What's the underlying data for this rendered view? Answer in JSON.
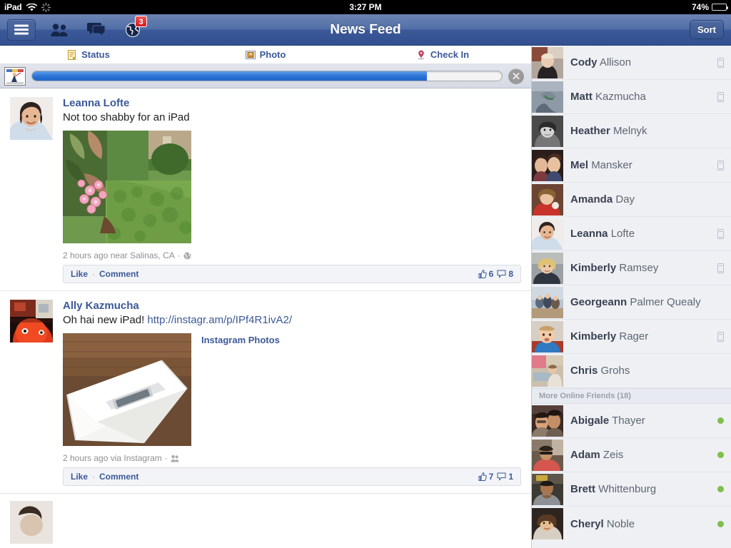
{
  "status_bar": {
    "carrier": "iPad",
    "wifi_icon": "wifi-icon",
    "activity_icon": "activity-spinner-icon",
    "time": "3:27 PM",
    "battery_percent": "74%",
    "battery_level": 74
  },
  "nav": {
    "menu_icon": "hamburger-menu-icon",
    "friends_icon": "friend-requests-icon",
    "messages_icon": "messages-icon",
    "notifications_icon": "globe-notifications-icon",
    "notifications_badge": "3",
    "title": "News Feed",
    "sort_label": "Sort",
    "bar_color": "#3b5998"
  },
  "composer": {
    "items": [
      {
        "label": "Status",
        "icon": "status-note-icon"
      },
      {
        "label": "Photo",
        "icon": "photo-icon"
      },
      {
        "label": "Check In",
        "icon": "location-pin-icon"
      }
    ]
  },
  "upload": {
    "thumbnail_icon": "upload-thumbnail",
    "progress_percent": 84,
    "cancel_icon": "cancel-upload-icon",
    "cancel_label": "✕"
  },
  "feed": {
    "posts": [
      {
        "author": "Leanna Lofte",
        "avatar_icon": "avatar-leanna-lofte",
        "text": "Not too shabby for an iPad",
        "link_text": "",
        "attachment": {
          "type": "photo",
          "image_icon": "post-photo-garden-flowers",
          "title": ""
        },
        "meta": "2 hours ago near Salinas, CA",
        "meta_separator": "·",
        "privacy_icon": "globe-privacy-icon",
        "like_label": "Like",
        "comment_label": "Comment",
        "separator": "·",
        "like_count": "6",
        "comment_count": "8"
      },
      {
        "author": "Ally Kazmucha",
        "avatar_icon": "avatar-ally-kazmucha",
        "text": "Oh hai new iPad! ",
        "link_text": "http://instagr.am/p/IPf4R1ivA2/",
        "attachment": {
          "type": "link",
          "image_icon": "post-photo-ipad-box",
          "title": "Instagram Photos"
        },
        "meta": "2 hours ago via Instagram",
        "meta_separator": "·",
        "privacy_icon": "friends-privacy-icon",
        "like_label": "Like",
        "comment_label": "Comment",
        "separator": "·",
        "like_count": "7",
        "comment_count": "1"
      }
    ]
  },
  "sidebar": {
    "friends": [
      {
        "first": "Cody",
        "last": "Allison",
        "avatar_icon": "avatar-cody-allison",
        "status_icon": "mobile-icon"
      },
      {
        "first": "Matt",
        "last": "Kazmucha",
        "avatar_icon": "avatar-matt-kazmucha",
        "status_icon": "mobile-icon"
      },
      {
        "first": "Heather",
        "last": "Melnyk",
        "avatar_icon": "avatar-heather-melnyk",
        "status_icon": "none"
      },
      {
        "first": "Mel",
        "last": "Mansker",
        "avatar_icon": "avatar-mel-mansker",
        "status_icon": "mobile-icon"
      },
      {
        "first": "Amanda",
        "last": "Day",
        "avatar_icon": "avatar-amanda-day",
        "status_icon": "none"
      },
      {
        "first": "Leanna",
        "last": "Lofte",
        "avatar_icon": "avatar-leanna-lofte",
        "status_icon": "mobile-icon"
      },
      {
        "first": "Kimberly",
        "last": "Ramsey",
        "avatar_icon": "avatar-kimberly-ramsey",
        "status_icon": "mobile-icon"
      },
      {
        "first": "Georgeann",
        "last": "Palmer Quealy",
        "avatar_icon": "avatar-georgeann-palmer-quealy",
        "status_icon": "none"
      },
      {
        "first": "Kimberly",
        "last": "Rager",
        "avatar_icon": "avatar-kimberly-rager",
        "status_icon": "mobile-icon"
      },
      {
        "first": "Chris",
        "last": "Grohs",
        "avatar_icon": "avatar-chris-grohs",
        "status_icon": "none"
      }
    ],
    "section_label": "More Online Friends (18)",
    "online_friends": [
      {
        "first": "Abigale",
        "last": "Thayer",
        "avatar_icon": "avatar-abigale-thayer",
        "status_icon": "online-dot"
      },
      {
        "first": "Adam",
        "last": "Zeis",
        "avatar_icon": "avatar-adam-zeis",
        "status_icon": "online-dot"
      },
      {
        "first": "Brett",
        "last": "Whittenburg",
        "avatar_icon": "avatar-brett-whittenburg",
        "status_icon": "online-dot"
      },
      {
        "first": "Cheryl",
        "last": "Noble",
        "avatar_icon": "avatar-cheryl-noble",
        "status_icon": "online-dot"
      }
    ],
    "online_color": "#7fbf4d"
  }
}
